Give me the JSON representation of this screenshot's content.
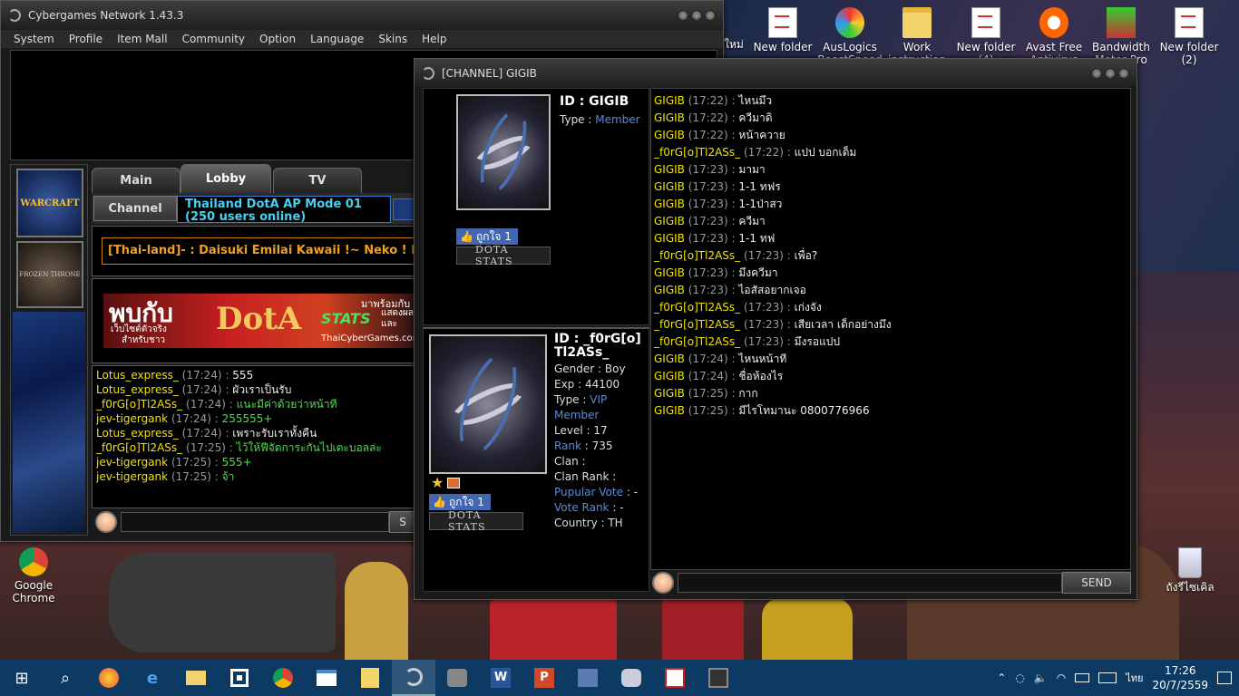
{
  "desktop": {
    "icons": [
      {
        "label": "New folder",
        "label2": ""
      },
      {
        "label": "AusLogics",
        "label2": "BoostSpeed"
      },
      {
        "label": "Work",
        "label2": "instruction"
      },
      {
        "label": "New folder",
        "label2": "(4)"
      },
      {
        "label": "Avast Free",
        "label2": "Antivirus"
      },
      {
        "label": "Bandwidth",
        "label2": "Meter Pro"
      },
      {
        "label": "New folder",
        "label2": "(2)"
      }
    ],
    "partial_label": "ใหม่",
    "chrome_label1": "Google",
    "chrome_label2": "Chrome",
    "recycle_label": "ถังรีไซเคิล"
  },
  "main_window": {
    "title": "Cybergames Network 1.43.3",
    "menu": [
      "System",
      "Profile",
      "Item Mall",
      "Community",
      "Option",
      "Language",
      "Skins",
      "Help"
    ],
    "tabs": [
      "Main",
      "Lobby",
      "TV"
    ],
    "channel_label": "Channel",
    "channel_name": "Thailand DotA AP Mode 01 (250 users online)",
    "marquee": "[Thai-land]- : Daisuki Emilai Kawaii !~ Neko ! Ne",
    "banner": {
      "big": "พบกับ",
      "small1": "เว็บไซต์ตัวจริง",
      "small2": "สำหรับชาว",
      "dota": "DotA",
      "stats": "STATS",
      "right1": "มาพร้อมกับ",
      "right2": "แสดงผล",
      "right3": "และ",
      "site": "ThaiCyberGames.com"
    },
    "chat": [
      {
        "name": "Lotus_express_",
        "time": "(17:24)",
        "msg": "555",
        "nc": "yellow",
        "mc": "white"
      },
      {
        "name": "Lotus_express_",
        "time": "(17:24)",
        "msg": "ผัวเราเป็นรับ",
        "nc": "yellow",
        "mc": "white"
      },
      {
        "name": "_f0rG[o]Tl2ASs_",
        "time": "(17:24)",
        "msg": "แนะมีค่าด้วยว่าหน้าที",
        "nc": "yellow",
        "mc": "green"
      },
      {
        "name": "jev-tigergank",
        "time": "(17:24)",
        "msg": "255555+",
        "nc": "yellow",
        "mc": "green"
      },
      {
        "name": "Lotus_express_",
        "time": "(17:24)",
        "msg": "เพราะรับเราทั้งคืน",
        "nc": "yellow",
        "mc": "white"
      },
      {
        "name": "_f0rG[o]Tl2ASs_",
        "time": "(17:25)",
        "msg": "ไว้ให้ฟีจัดการะกันไปเตะบอลล่ะ",
        "nc": "yellow",
        "mc": "green"
      },
      {
        "name": "jev-tigergank",
        "time": "(17:25)",
        "msg": "555+",
        "nc": "yellow",
        "mc": "green"
      },
      {
        "name": "jev-tigergank",
        "time": "(17:25)",
        "msg": "จ้า",
        "nc": "yellow",
        "mc": "green"
      }
    ],
    "send_label": "S",
    "game_icons": [
      "WARCRAFT",
      "FROZEN THRONE"
    ]
  },
  "channel_window": {
    "title": "[CHANNEL] GIGIB",
    "profile1": {
      "id": "ID : GIGIB",
      "type_label": "Type : ",
      "type_value": "Member",
      "like": "ถูกใจ 1",
      "stats": "DOTA STATS"
    },
    "profile2": {
      "id_line1": "ID : _f0rG[o]",
      "id_line2": "Tl2ASs_",
      "gender": "Gender : Boy",
      "exp": "Exp : 44100",
      "type_label": "Type : ",
      "type_value": "VIP Member",
      "level": "Level : 17",
      "rank_label": "Rank",
      "rank_value": " : 735",
      "clan": "Clan :",
      "clan_rank": "Clan Rank :",
      "popular_label": "Pupular Vote",
      "popular_value": " : -",
      "vote_label": "Vote Rank",
      "vote_value": " : -",
      "country": "Country : TH",
      "like": "ถูกใจ 1",
      "stats": "DOTA STATS"
    },
    "chat": [
      {
        "name": "GIGIB",
        "time": "(17:22)",
        "msg": "ไหนมึว"
      },
      {
        "name": "GIGIB",
        "time": "(17:22)",
        "msg": "ควีมาดิ"
      },
      {
        "name": "GIGIB",
        "time": "(17:22)",
        "msg": "หน้าควาย"
      },
      {
        "name": "_f0rG[o]Tl2ASs_",
        "time": "(17:22)",
        "msg": "แปป บอกเต็ม"
      },
      {
        "name": "GIGIB",
        "time": "(17:23)",
        "msg": "มามา"
      },
      {
        "name": "GIGIB",
        "time": "(17:23)",
        "msg": "1-1 ทฟร"
      },
      {
        "name": "GIGIB",
        "time": "(17:23)",
        "msg": "1-1ป่าสว"
      },
      {
        "name": "GIGIB",
        "time": "(17:23)",
        "msg": "ควีมา"
      },
      {
        "name": "GIGIB",
        "time": "(17:23)",
        "msg": "1-1 ทฟ"
      },
      {
        "name": "_f0rG[o]Tl2ASs_",
        "time": "(17:23)",
        "msg": "เพื่อ?"
      },
      {
        "name": "GIGIB",
        "time": "(17:23)",
        "msg": "มึงควีมา"
      },
      {
        "name": "GIGIB",
        "time": "(17:23)",
        "msg": "ไอสัสอยากเจอ"
      },
      {
        "name": "_f0rG[o]Tl2ASs_",
        "time": "(17:23)",
        "msg": "เก่งจัง"
      },
      {
        "name": "_f0rG[o]Tl2ASs_",
        "time": "(17:23)",
        "msg": "เสียเวลา เด็กอย่างมึง"
      },
      {
        "name": "_f0rG[o]Tl2ASs_",
        "time": "(17:23)",
        "msg": "มึงรอแปป"
      },
      {
        "name": "GIGIB",
        "time": "(17:24)",
        "msg": "ไหนหน้าที"
      },
      {
        "name": "GIGIB",
        "time": "(17:24)",
        "msg": "ชื่อห้องไร"
      },
      {
        "name": "GIGIB",
        "time": "(17:25)",
        "msg": "กาก"
      },
      {
        "name": "GIGIB",
        "time": "(17:25)",
        "msg": "มีไรโทมานะ 0800776966"
      }
    ],
    "send_label": "SEND"
  },
  "taskbar": {
    "icons": [
      "start-icon",
      "search-icon",
      "firefox-icon",
      "edge-icon",
      "file-explorer-icon",
      "store-icon",
      "chrome-icon",
      "window-icon",
      "folder-icon",
      "cybergames-icon",
      "game-icon",
      "word-icon",
      "powerpoint-icon",
      "app-icon",
      "tool-icon",
      "acrobat-icon",
      "warcraft-icon"
    ],
    "tray_lang": "ไทย",
    "time": "17:26",
    "date": "20/7/2559"
  }
}
